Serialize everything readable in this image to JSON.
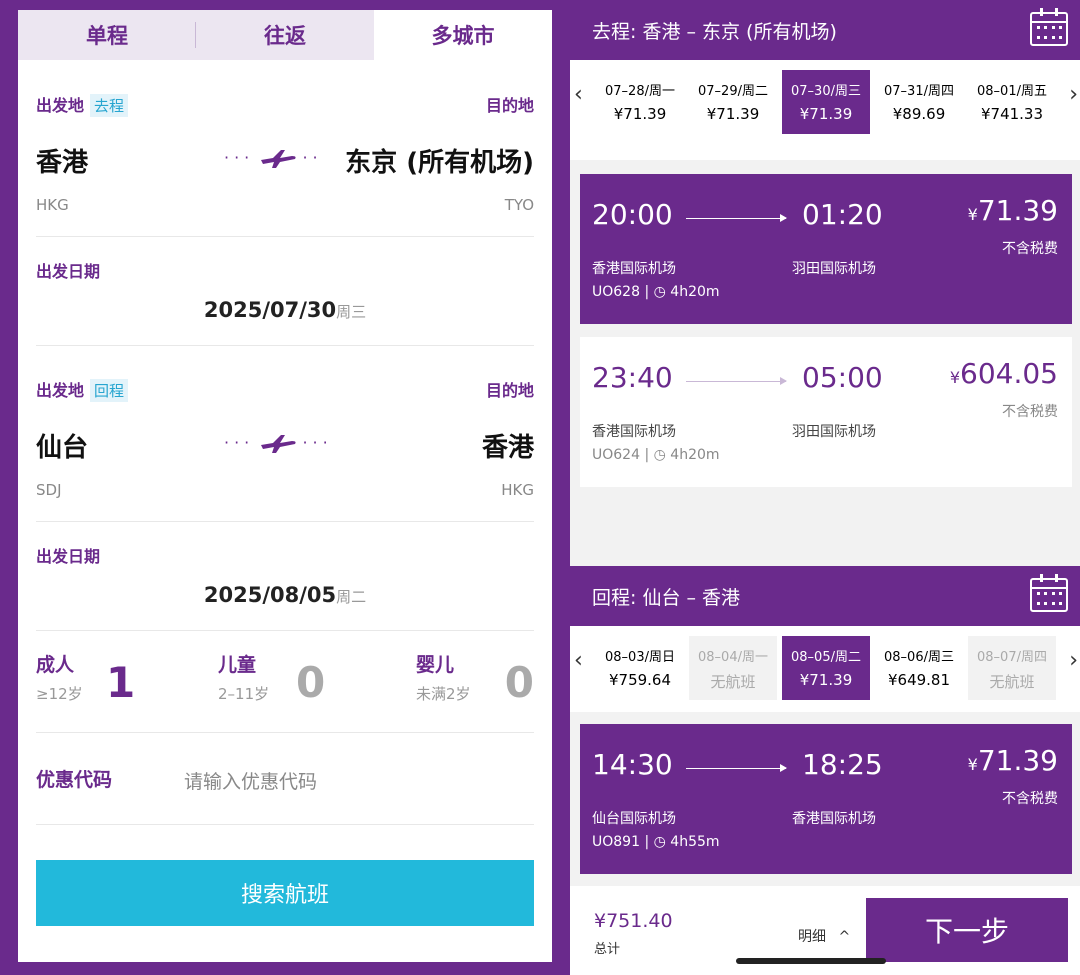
{
  "tabs": [
    "单程",
    "往返",
    "多城市"
  ],
  "leg1": {
    "from_label": "出发地",
    "badge": "去程",
    "to_label": "目的地",
    "from_city": "香港",
    "to_city": "东京 (所有机场)",
    "from_code": "HKG",
    "to_code": "TYO",
    "date_label": "出发日期",
    "date": "2025/07/30",
    "weekday": "周三"
  },
  "leg2": {
    "from_label": "出发地",
    "badge": "回程",
    "to_label": "目的地",
    "from_city": "仙台",
    "to_city": "香港",
    "from_code": "SDJ",
    "to_code": "HKG",
    "date_label": "出发日期",
    "date": "2025/08/05",
    "weekday": "周二"
  },
  "passengers": [
    {
      "label": "成人",
      "sub": "≥12岁",
      "count": "1"
    },
    {
      "label": "儿童",
      "sub": "2–11岁",
      "count": "0"
    },
    {
      "label": "婴儿",
      "sub": "未满2岁",
      "count": "0"
    }
  ],
  "promo": {
    "label": "优惠代码",
    "placeholder": "请输入优惠代码"
  },
  "search_button": "搜索航班",
  "outbound": {
    "title": "去程:  香港 – 东京 (所有机场)",
    "dates": [
      {
        "d": "07–28/周一",
        "p": "¥71.39",
        "state": "normal"
      },
      {
        "d": "07–29/周二",
        "p": "¥71.39",
        "state": "normal"
      },
      {
        "d": "07–30/周三",
        "p": "¥71.39",
        "state": "selected"
      },
      {
        "d": "07–31/周四",
        "p": "¥89.69",
        "state": "normal"
      },
      {
        "d": "08–01/周五",
        "p": "¥741.33",
        "state": "normal"
      }
    ],
    "flights": [
      {
        "dep": "20:00",
        "arr": "01:20",
        "price": "71.39",
        "tax": "不含税费",
        "dep_ap": "香港国际机场",
        "arr_ap": "羽田国际机场",
        "flight": "UO628",
        "duration": "4h20m",
        "selected": true
      },
      {
        "dep": "23:40",
        "arr": "05:00",
        "price": "604.05",
        "tax": "不含税费",
        "dep_ap": "香港国际机场",
        "arr_ap": "羽田国际机场",
        "flight": "UO624",
        "duration": "4h20m",
        "selected": false
      }
    ]
  },
  "inbound": {
    "title": "回程:  仙台 – 香港",
    "dates": [
      {
        "d": "08–03/周日",
        "p": "¥759.64",
        "state": "normal"
      },
      {
        "d": "08–04/周一",
        "p": "无航班",
        "state": "disabled"
      },
      {
        "d": "08–05/周二",
        "p": "¥71.39",
        "state": "selected"
      },
      {
        "d": "08–06/周三",
        "p": "¥649.81",
        "state": "normal"
      },
      {
        "d": "08–07/周四",
        "p": "无航班",
        "state": "disabled"
      }
    ],
    "flights": [
      {
        "dep": "14:30",
        "arr": "18:25",
        "price": "71.39",
        "tax": "不含税费",
        "dep_ap": "仙台国际机场",
        "arr_ap": "香港国际机场",
        "flight": "UO891",
        "duration": "4h55m",
        "selected": true
      }
    ]
  },
  "footer": {
    "total_price": "¥751.40",
    "total_label": "总计",
    "detail": "明细",
    "next": "下一步"
  },
  "currency": "¥",
  "colors": {
    "brand_purple": "#6a2a8c",
    "search_blue": "#22b9db"
  }
}
